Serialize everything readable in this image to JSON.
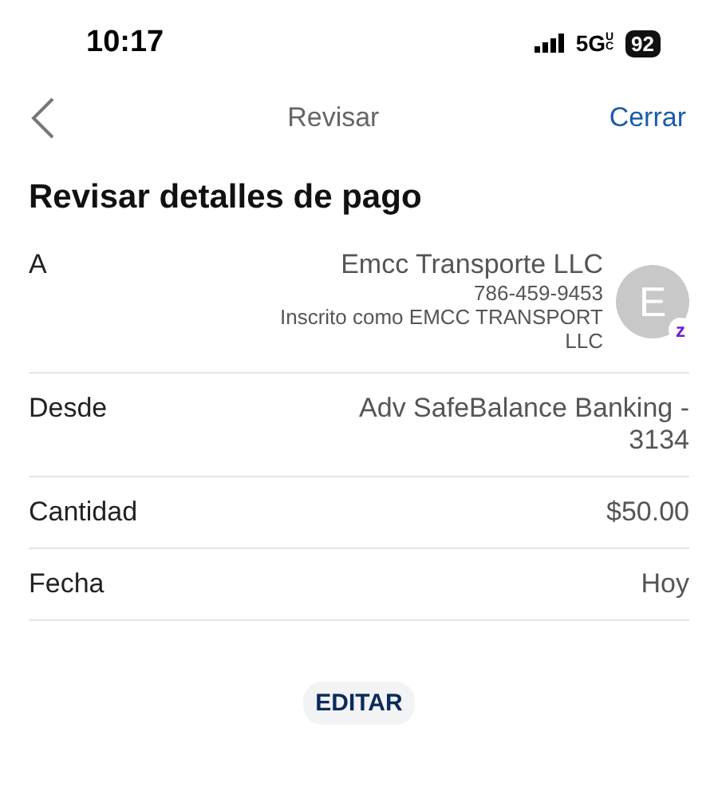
{
  "status_bar": {
    "time": "10:17",
    "network": "5G",
    "network_sub": "UC",
    "battery": "92"
  },
  "nav": {
    "title": "Revisar",
    "close": "Cerrar"
  },
  "heading": "Revisar detalles de pago",
  "recipient": {
    "label": "A",
    "name": "Emcc Transporte LLC",
    "phone": "786-459-9453",
    "enrolled": "Inscrito como EMCC TRANSPORT LLC",
    "avatar": "E",
    "badge": "z"
  },
  "rows": [
    {
      "label": "Desde",
      "value": "Adv SafeBalance Banking - 3134"
    },
    {
      "label": "Cantidad",
      "value": "$50.00"
    },
    {
      "label": "Fecha",
      "value": "Hoy"
    }
  ],
  "edit_button": "EDITAR"
}
